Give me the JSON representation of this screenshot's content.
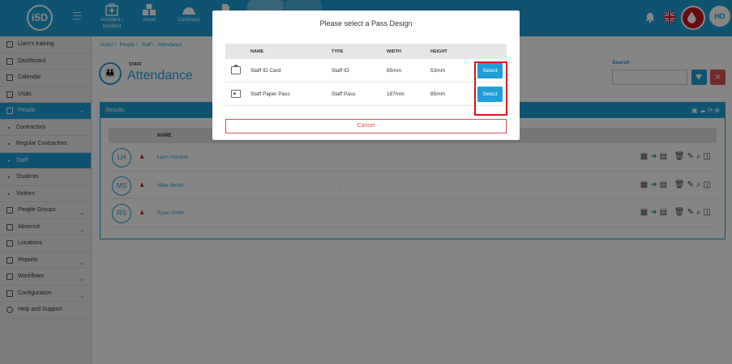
{
  "app": {
    "logo": "i5D",
    "avatar_initials": "HD"
  },
  "nav_tabs": [
    {
      "label": "Accident /\nIncident",
      "icon": "first-aid-icon"
    },
    {
      "label": "Asset",
      "icon": "boxes-icon"
    },
    {
      "label": "Contracts",
      "icon": "hardhat-icon"
    }
  ],
  "sidebar": {
    "items": [
      {
        "label": "Liam's training",
        "icon": "branch-icon"
      },
      {
        "label": "Dashboard",
        "icon": "dashboard-icon"
      },
      {
        "label": "Calendar",
        "icon": "calendar-icon"
      },
      {
        "label": "Visits",
        "icon": "visits-icon"
      },
      {
        "label": "People",
        "icon": "people-icon",
        "active": true
      },
      {
        "label": "Contractors",
        "sub": true
      },
      {
        "label": "Regular Contractors",
        "sub": true
      },
      {
        "label": "Staff",
        "sub": true,
        "active": true
      },
      {
        "label": "Students",
        "sub": true
      },
      {
        "label": "Visitors",
        "sub": true
      },
      {
        "label": "People Groups",
        "icon": "groups-icon",
        "chevron": true
      },
      {
        "label": "Absence",
        "icon": "absence-icon",
        "chevron": true
      },
      {
        "label": "Locations",
        "icon": "locations-icon"
      },
      {
        "label": "Reports",
        "icon": "reports-icon",
        "chevron": true
      },
      {
        "label": "Workflows",
        "icon": "workflows-icon",
        "chevron": true
      },
      {
        "label": "Configuration",
        "icon": "configuration-icon",
        "chevron": true
      },
      {
        "label": "Help and Support",
        "icon": "help-icon"
      }
    ]
  },
  "breadcrumb": [
    "Visitor /",
    "People /",
    "Staff /",
    "Attendance"
  ],
  "page": {
    "kicker": "STAFF",
    "title": "Attendance",
    "search_label": "Search"
  },
  "results": {
    "header": "Results",
    "column_name": "NAME",
    "rows": [
      {
        "initials": "LH",
        "name": "Liam Hanson",
        "d1": "-",
        "d2": "-",
        "d3": "-"
      },
      {
        "initials": "MS",
        "name": "Mike Smith",
        "d1": "-",
        "d2": "-",
        "d3": "-"
      },
      {
        "initials": "RS",
        "name": "Ryan Smith",
        "d1": "-",
        "d2": "-",
        "d3": "-"
      }
    ]
  },
  "modal": {
    "title": "Please select a Pass Design",
    "columns": [
      "NAME",
      "TYPE",
      "WIDTH",
      "HEIGHT"
    ],
    "rows": [
      {
        "name": "Staff ID Card",
        "type": "Staff ID",
        "width": "85mm",
        "height": "53mm",
        "button": "Select"
      },
      {
        "name": "Staff Paper Pass",
        "type": "Staff Pass",
        "width": "187mm",
        "height": "85mm",
        "button": "Select"
      }
    ],
    "cancel": "Cancel"
  },
  "colors": {
    "primary": "#1f9fd8",
    "danger": "#d9141f",
    "highlight": "#d9141f"
  }
}
